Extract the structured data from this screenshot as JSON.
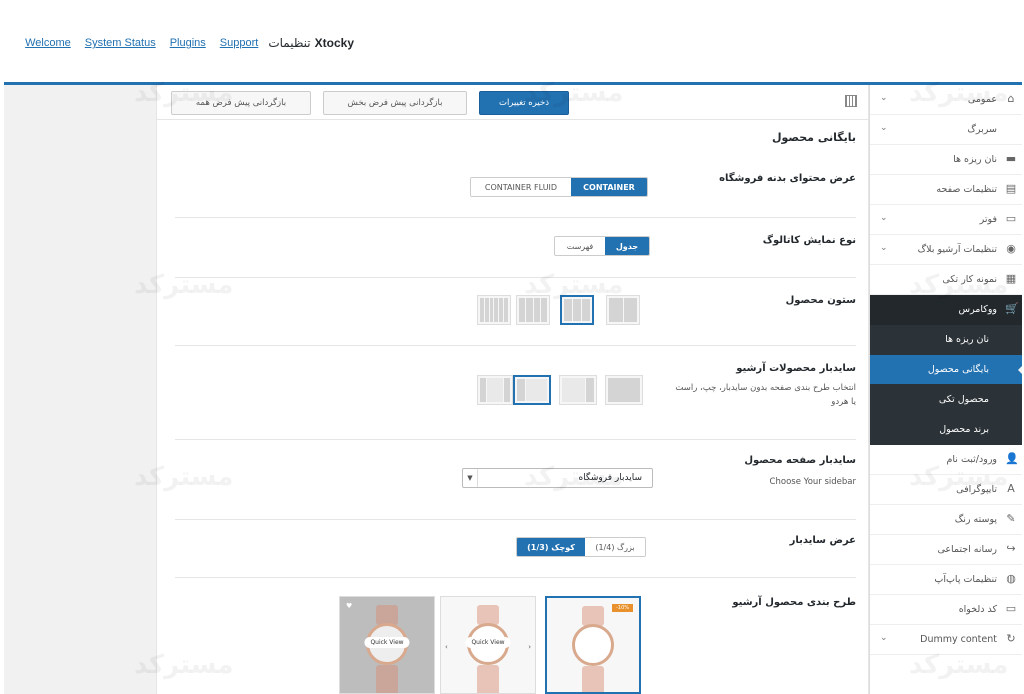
{
  "header": {
    "links": [
      "Welcome",
      "System Status",
      "Plugins",
      "Support"
    ],
    "title_word": "تنظیمات",
    "title_brand": "Xtocky"
  },
  "toolbar": {
    "save": "ذخیره تغییرات",
    "reset_section": "بازگردانی پیش فرض بخش",
    "reset_all": "بازگردانی پیش فرض همه"
  },
  "sidebar": {
    "items": [
      {
        "label": "عمومی",
        "icon": "home-icon",
        "chevron": true
      },
      {
        "label": "سربرگ",
        "icon": "none",
        "chevron": true
      },
      {
        "label": "نان ریزه ها",
        "icon": "breadcrumb-icon",
        "chevron": false
      },
      {
        "label": "تنظیمات صفحه",
        "icon": "page-icon",
        "chevron": false
      },
      {
        "label": "فوتر",
        "icon": "footer-icon",
        "chevron": true
      },
      {
        "label": "تنظیمات آرشیو بلاگ",
        "icon": "compass-icon",
        "chevron": true
      },
      {
        "label": "نمونه کار تکی",
        "icon": "grid-icon",
        "chevron": false
      },
      {
        "label": "ووکامرس",
        "icon": "cart-icon",
        "chevron": false
      }
    ],
    "sub_items": [
      "نان ریزه ها",
      "بایگانی محصول",
      "محصول تکی",
      "برند محصول"
    ],
    "items_after": [
      {
        "label": "ورود/ثبت نام",
        "icon": "user-icon",
        "chevron": false
      },
      {
        "label": "تایپوگرافی",
        "icon": "font-icon",
        "chevron": false
      },
      {
        "label": "پوسته رنگ",
        "icon": "brush-icon",
        "chevron": false
      },
      {
        "label": "رسانه اجتماعی",
        "icon": "share-icon",
        "chevron": false
      },
      {
        "label": "تنظیمات پاپ‌آپ",
        "icon": "popup-icon",
        "chevron": false
      },
      {
        "label": "کد دلخواه",
        "icon": "code-icon",
        "chevron": false
      },
      {
        "label": "Dummy content",
        "icon": "refresh-icon",
        "chevron": true
      }
    ]
  },
  "main": {
    "section_title": "بایگانی محصول",
    "shop_width": {
      "label": "عرض محتوای بدنه فروشگاه",
      "options": [
        "CONTAINER",
        "CONTAINER FLUID"
      ]
    },
    "catalog_type": {
      "label": "نوع نمایش کاتالوگ",
      "options": [
        "جدول",
        "فهرست"
      ]
    },
    "columns": {
      "label": "ستون محصول",
      "selected_columns": 3
    },
    "archive_sidebar": {
      "label": "سایدبار محصولات آرشیو",
      "desc1": "انتخاب طرح بندی صفحه بدون سایدبار، چپ، راست",
      "desc2": "یا هردو"
    },
    "page_sidebar": {
      "label": "سایدبار صفحه محصول",
      "desc": "Choose Your sidebar",
      "value": "سایدبار فروشگاه"
    },
    "sidebar_width": {
      "label": "عرض سایدبار",
      "options": [
        "کوچک (1/3)",
        "بزرگ (1/4)"
      ]
    },
    "archive_layout": {
      "label": "طرح بندی محصول آرشیو",
      "sale_badge": "-10%",
      "quick_view": "Quick View"
    }
  },
  "watermark": "مسترکد",
  "colors": {
    "accent": "#2271b1",
    "sidebar_dark": "#23282d"
  }
}
